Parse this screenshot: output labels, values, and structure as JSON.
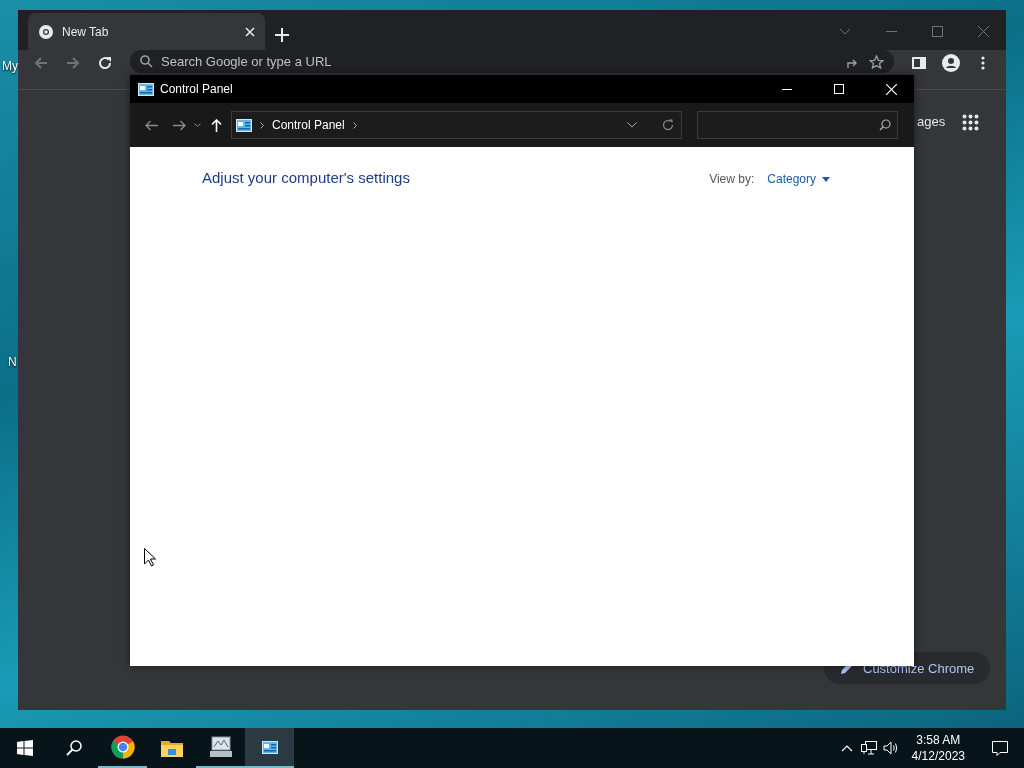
{
  "desktop": {
    "icon_labels": [
      "My",
      "N"
    ]
  },
  "browser": {
    "tabs": [
      {
        "label": "New Tab",
        "selected": true
      }
    ],
    "omnibox": {
      "placeholder": "Search Google or type a URL"
    },
    "images_link": "ages",
    "customize_button": "Customize Chrome"
  },
  "control_panel": {
    "title": "Control Panel",
    "breadcrumb": [
      "Control Panel"
    ],
    "heading": "Adjust your computer's settings",
    "view_by": {
      "label": "View by:",
      "value": "Category"
    }
  },
  "taskbar": {
    "apps": [
      {
        "kind": "chrome",
        "running": true,
        "selected": false
      },
      {
        "kind": "explorer",
        "running": false,
        "selected": false
      },
      {
        "kind": "monitor",
        "running": true,
        "selected": false
      },
      {
        "kind": "control",
        "running": true,
        "selected": true
      }
    ],
    "clock": {
      "time": "3:58 AM",
      "date": "4/12/2023"
    }
  }
}
